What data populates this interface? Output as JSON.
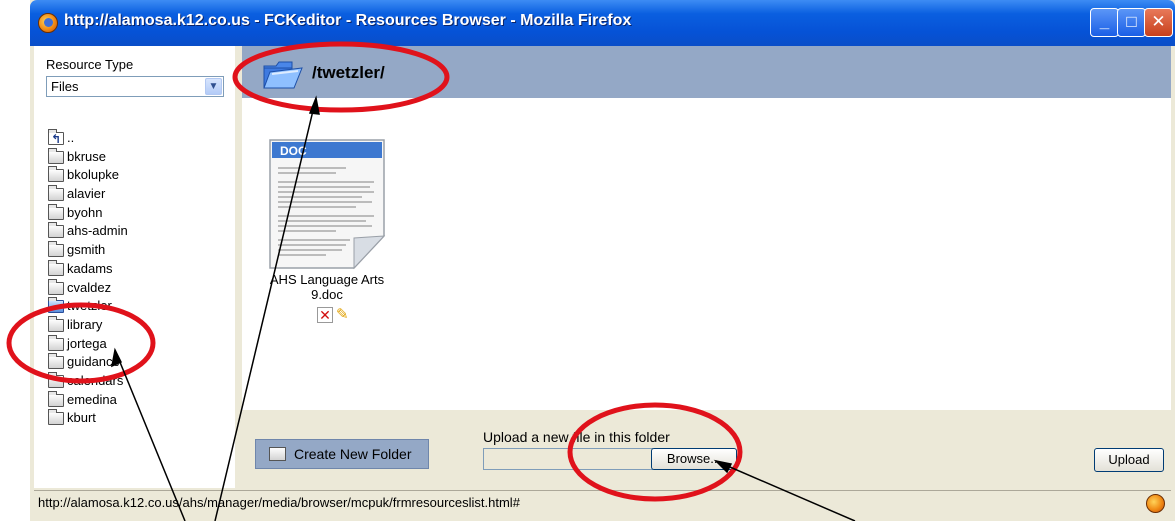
{
  "window": {
    "title": "http://alamosa.k12.co.us - FCKeditor - Resources Browser - Mozilla Firefox",
    "controls": {
      "minimize": "_",
      "maximize": "□",
      "close": "✕"
    }
  },
  "sidebar": {
    "resource_type_label": "Resource Type",
    "resource_type_value": "Files",
    "folders": [
      {
        "label": "..",
        "icon": "parent-folder-icon"
      },
      {
        "label": "bkruse",
        "icon": "folder-icon"
      },
      {
        "label": "bkolupke",
        "icon": "folder-icon"
      },
      {
        "label": "alavier",
        "icon": "folder-icon"
      },
      {
        "label": "byohn",
        "icon": "folder-icon"
      },
      {
        "label": "ahs-admin",
        "icon": "folder-icon"
      },
      {
        "label": "gsmith",
        "icon": "folder-icon"
      },
      {
        "label": "kadams",
        "icon": "folder-icon"
      },
      {
        "label": "cvaldez",
        "icon": "folder-icon"
      },
      {
        "label": "twetzler",
        "icon": "open-folder-icon",
        "selected": true
      },
      {
        "label": "library",
        "icon": "folder-icon"
      },
      {
        "label": "jortega",
        "icon": "folder-icon"
      },
      {
        "label": "guidance",
        "icon": "folder-icon"
      },
      {
        "label": "calendars",
        "icon": "folder-icon"
      },
      {
        "label": "emedina",
        "icon": "folder-icon"
      },
      {
        "label": "kburt",
        "icon": "folder-icon"
      }
    ]
  },
  "header": {
    "current_path": "/twetzler/"
  },
  "files": [
    {
      "name_line1": "AHS Language Arts",
      "name_line2": "9.doc",
      "badge": "DOC"
    }
  ],
  "bottom": {
    "create_folder_label": "Create New Folder",
    "upload_label": "Upload a new file in this folder",
    "upload_field_value": "",
    "browse_label": "Browse...",
    "upload_button_label": "Upload"
  },
  "status": {
    "url": "http://alamosa.k12.co.us/ahs/manager/media/browser/mcpuk/frmresourceslist.html#"
  },
  "colors": {
    "titlebar": "#0a5fe0",
    "header_bg": "#94a8c6",
    "panel_bg": "#ece9d8",
    "annotation_red": "#e0121b"
  }
}
